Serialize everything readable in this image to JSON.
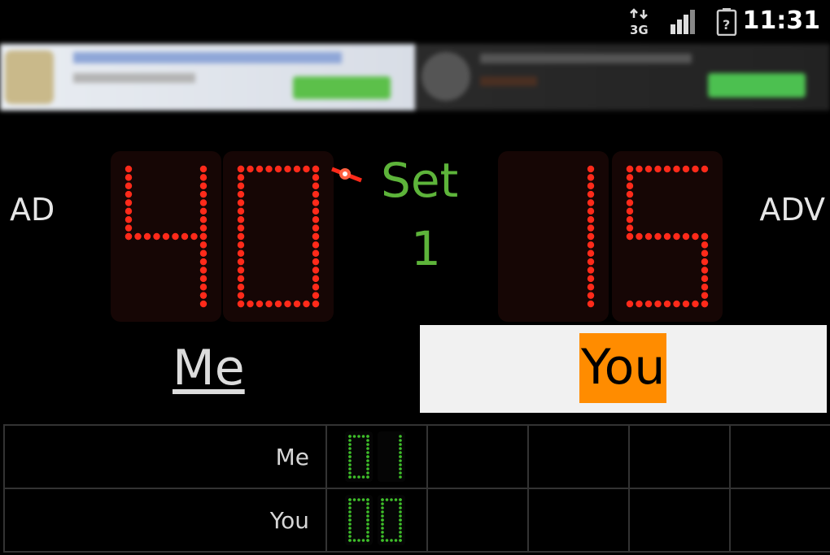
{
  "status_bar": {
    "network": "3G",
    "time": "11:31"
  },
  "ad_banner": {
    "label": "ad banner"
  },
  "scoreboard": {
    "left_status": "AD",
    "right_status": "ADV",
    "me_score": "40",
    "you_score": "15",
    "set_label": "Set",
    "set_number": "1",
    "digit_color": "#ff2a1a",
    "set_color": "#5db43a"
  },
  "players": {
    "me": "Me",
    "you": "You",
    "you_highlight": "#ff8c00"
  },
  "sets_table": {
    "rows": [
      {
        "name": "Me",
        "digits": [
          "0",
          "1"
        ]
      },
      {
        "name": "You",
        "digits": [
          "0",
          "0"
        ]
      }
    ],
    "digit_color": "#3fbf2a"
  }
}
